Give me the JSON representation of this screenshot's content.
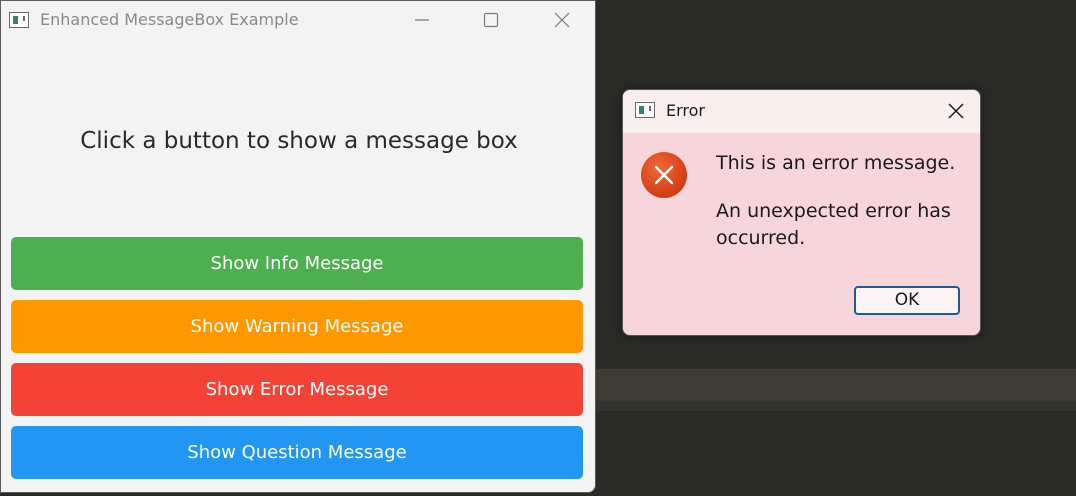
{
  "main_window": {
    "title": "Enhanced MessageBox Example",
    "prompt": "Click a button to show a message box",
    "buttons": [
      {
        "label": "Show Info Message",
        "color": "#4caf50"
      },
      {
        "label": "Show Warning Message",
        "color": "#ff9800"
      },
      {
        "label": "Show Error Message",
        "color": "#f44336"
      },
      {
        "label": "Show Question Message",
        "color": "#2196f3"
      }
    ],
    "controls": [
      "minimize-icon",
      "maximize-icon",
      "close-icon"
    ]
  },
  "dialog": {
    "title": "Error",
    "icon": "error-icon",
    "message": "This is an error message.",
    "detail": "An unexpected error has occurred.",
    "ok_label": "OK",
    "background_color": "#f7d6db",
    "icon_color": "#e8491d"
  }
}
